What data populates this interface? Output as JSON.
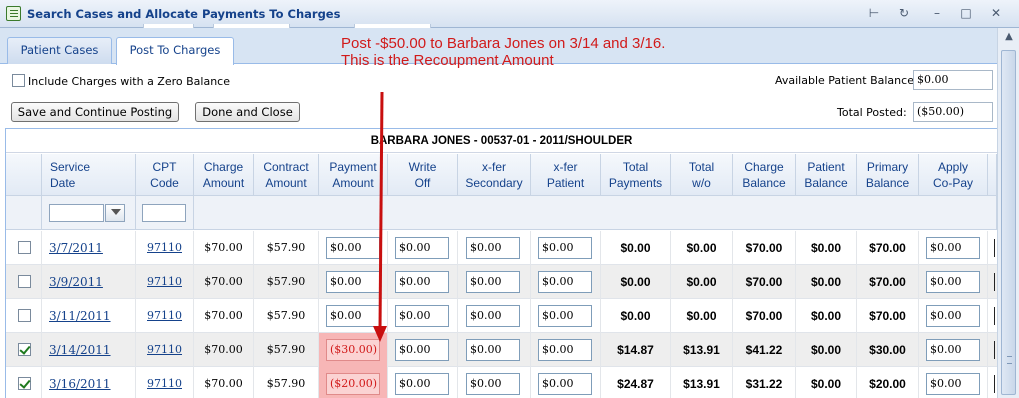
{
  "window": {
    "title": "Search Cases and Allocate Payments To Charges",
    "controls": [
      "pin-icon",
      "refresh-icon",
      "minimize-icon",
      "maximize-icon",
      "close-icon"
    ]
  },
  "tabs": [
    {
      "label": "Patient Cases",
      "active": false
    },
    {
      "label": "Post To Charges",
      "active": true
    }
  ],
  "annotation": {
    "line1": "Post -$50.00 to Barbara Jones on 3/14 and 3/16.",
    "line2": "This is the Recoupment Amount",
    "color": "#d11a1a"
  },
  "options": {
    "include_zero_label": "Include Charges with a Zero Balance",
    "include_zero_checked": false,
    "save_continue_label": "Save and Continue Posting",
    "done_close_label": "Done and Close",
    "available_balance_label": "Available Patient Balance:",
    "available_balance_value": "$0.00",
    "total_posted_label": "Total Posted:",
    "total_posted_value": "($50.00)"
  },
  "grid": {
    "group_header": "BARBARA JONES - 00537-01 - 2011/SHOULDER",
    "columns": [
      {
        "l1": "Service",
        "l2": "Date"
      },
      {
        "l1": "CPT",
        "l2": "Code"
      },
      {
        "l1": "Charge",
        "l2": "Amount"
      },
      {
        "l1": "Contract",
        "l2": "Amount"
      },
      {
        "l1": "Payment",
        "l2": "Amount"
      },
      {
        "l1": "Write",
        "l2": "Off"
      },
      {
        "l1": "x-fer",
        "l2": "Secondary"
      },
      {
        "l1": "x-fer",
        "l2": "Patient"
      },
      {
        "l1": "Total",
        "l2": "Payments"
      },
      {
        "l1": "Total",
        "l2": "w/o"
      },
      {
        "l1": "Charge",
        "l2": "Balance"
      },
      {
        "l1": "Patient",
        "l2": "Balance"
      },
      {
        "l1": "Primary",
        "l2": "Balance"
      },
      {
        "l1": "Apply",
        "l2": "Co-Pay"
      }
    ],
    "rows": [
      {
        "checked": false,
        "date": "3/7/2011",
        "cpt": "97110",
        "charge": "$70.00",
        "contract": "$57.90",
        "payment": "$0.00",
        "payment_highlight": false,
        "write_off": "$0.00",
        "xfer_secondary": "$0.00",
        "xfer_patient": "$0.00",
        "total_payments": "$0.00",
        "total_wo": "$0.00",
        "charge_balance": "$70.00",
        "patient_balance": "$0.00",
        "primary_balance": "$70.00",
        "copay": "$0.00"
      },
      {
        "checked": false,
        "date": "3/9/2011",
        "cpt": "97110",
        "charge": "$70.00",
        "contract": "$57.90",
        "payment": "$0.00",
        "payment_highlight": false,
        "write_off": "$0.00",
        "xfer_secondary": "$0.00",
        "xfer_patient": "$0.00",
        "total_payments": "$0.00",
        "total_wo": "$0.00",
        "charge_balance": "$70.00",
        "patient_balance": "$0.00",
        "primary_balance": "$70.00",
        "copay": "$0.00"
      },
      {
        "checked": false,
        "date": "3/11/2011",
        "cpt": "97110",
        "charge": "$70.00",
        "contract": "$57.90",
        "payment": "$0.00",
        "payment_highlight": false,
        "write_off": "$0.00",
        "xfer_secondary": "$0.00",
        "xfer_patient": "$0.00",
        "total_payments": "$0.00",
        "total_wo": "$0.00",
        "charge_balance": "$70.00",
        "patient_balance": "$0.00",
        "primary_balance": "$70.00",
        "copay": "$0.00"
      },
      {
        "checked": true,
        "date": "3/14/2011",
        "cpt": "97110",
        "charge": "$70.00",
        "contract": "$57.90",
        "payment": "($30.00)",
        "payment_highlight": true,
        "write_off": "$0.00",
        "xfer_secondary": "$0.00",
        "xfer_patient": "$0.00",
        "total_payments": "$14.87",
        "total_wo": "$13.91",
        "charge_balance": "$41.22",
        "patient_balance": "$0.00",
        "primary_balance": "$30.00",
        "copay": "$0.00"
      },
      {
        "checked": true,
        "date": "3/16/2011",
        "cpt": "97110",
        "charge": "$70.00",
        "contract": "$57.90",
        "payment": "($20.00)",
        "payment_highlight": true,
        "write_off": "$0.00",
        "xfer_secondary": "$0.00",
        "xfer_patient": "$0.00",
        "total_payments": "$24.87",
        "total_wo": "$13.91",
        "charge_balance": "$31.22",
        "patient_balance": "$0.00",
        "primary_balance": "$20.00",
        "copay": "$0.00"
      }
    ]
  }
}
